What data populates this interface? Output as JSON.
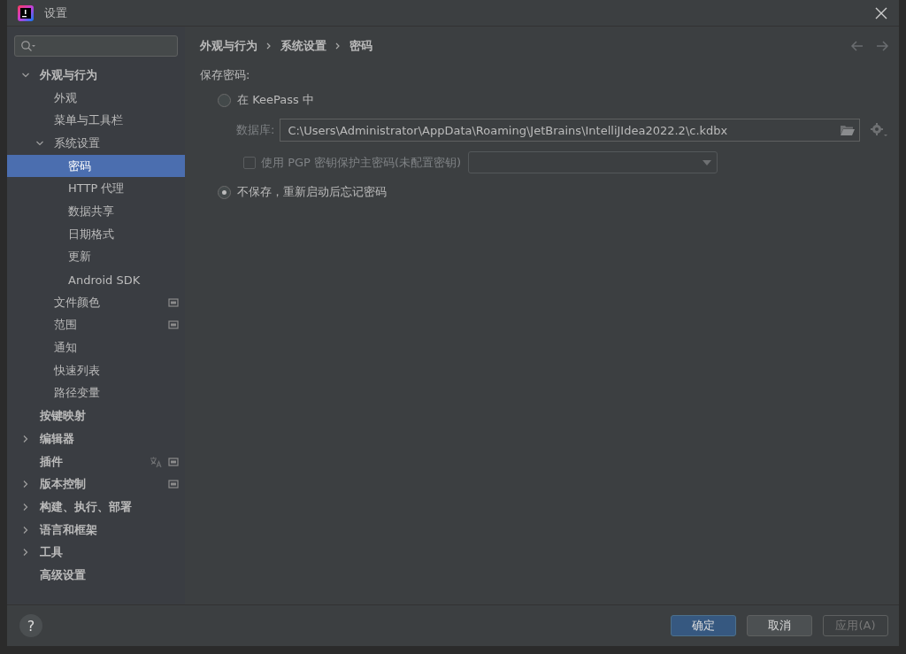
{
  "window": {
    "title": "设置"
  },
  "sidebar": {
    "items": [
      {
        "label": "外观与行为",
        "expanded": true,
        "selected": false,
        "children": [
          {
            "label": "外观",
            "selected": false
          },
          {
            "label": "菜单与工具栏",
            "selected": false
          },
          {
            "label": "系统设置",
            "expanded": true,
            "selected": false,
            "children": [
              {
                "label": "密码",
                "selected": true
              },
              {
                "label": "HTTP 代理",
                "selected": false
              },
              {
                "label": "数据共享",
                "selected": false
              },
              {
                "label": "日期格式",
                "selected": false
              },
              {
                "label": "更新",
                "selected": false
              },
              {
                "label": "Android SDK",
                "selected": false
              }
            ]
          },
          {
            "label": "文件颜色",
            "selected": false,
            "project_icon": true
          },
          {
            "label": "范围",
            "selected": false,
            "project_icon": true
          },
          {
            "label": "通知",
            "selected": false
          },
          {
            "label": "快速列表",
            "selected": false
          },
          {
            "label": "路径变量",
            "selected": false
          }
        ]
      },
      {
        "label": "按键映射",
        "selected": false
      },
      {
        "label": "编辑器",
        "expanded": false,
        "selected": false
      },
      {
        "label": "插件",
        "selected": false,
        "translate_icon": true,
        "project_icon": true
      },
      {
        "label": "版本控制",
        "expanded": false,
        "selected": false,
        "project_icon": true
      },
      {
        "label": "构建、执行、部署",
        "expanded": false,
        "selected": false
      },
      {
        "label": "语言和框架",
        "expanded": false,
        "selected": false
      },
      {
        "label": "工具",
        "expanded": false,
        "selected": false
      },
      {
        "label": "高级设置",
        "selected": false
      }
    ]
  },
  "content": {
    "breadcrumb": [
      "外观与行为",
      "系统设置",
      "密码"
    ],
    "section_label": "保存密码:",
    "keepass_option": {
      "label": "在 KeePass 中",
      "selected": false
    },
    "database": {
      "label": "数据库:",
      "value": "C:\\Users\\Administrator\\AppData\\Roaming\\JetBrains\\IntelliJIdea2022.2\\c.kdbx"
    },
    "pgp": {
      "label": "使用 PGP 密钥保护主密码(未配置密钥)",
      "checked": false
    },
    "no_save_option": {
      "label": "不保存，重新启动后忘记密码",
      "selected": true
    }
  },
  "footer": {
    "help": "?",
    "buttons": [
      {
        "label": "确定",
        "kind": "primary"
      },
      {
        "label": "取消",
        "kind": "normal"
      },
      {
        "label": "应用(A)",
        "kind": "disabled"
      }
    ]
  }
}
